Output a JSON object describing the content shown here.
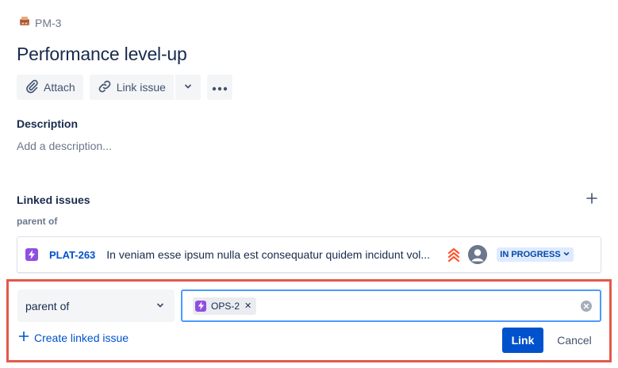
{
  "breadcrumb": {
    "issue_key": "PM-3"
  },
  "issue": {
    "title": "Performance level-up"
  },
  "toolbar": {
    "attach_label": "Attach",
    "link_issue_label": "Link issue"
  },
  "description": {
    "heading": "Description",
    "placeholder": "Add a description..."
  },
  "linked_issues": {
    "heading": "Linked issues",
    "groups": [
      {
        "type_label": "parent of",
        "items": [
          {
            "key": "PLAT-263",
            "summary": "In veniam esse ipsum nulla est consequatur quidem incidunt vol...",
            "priority_icon": "highest-priority-icon",
            "status": "IN PROGRESS"
          }
        ]
      }
    ]
  },
  "link_form": {
    "link_type_value": "parent of",
    "selected_issue": "OPS-2",
    "create_linked_label": "Create linked issue",
    "link_button_label": "Link",
    "cancel_button_label": "Cancel"
  },
  "colors": {
    "accent": "#0052cc",
    "epic_purple": "#904ee2",
    "highlight_border": "#e5574a",
    "priority_highest": "#ff5630"
  }
}
